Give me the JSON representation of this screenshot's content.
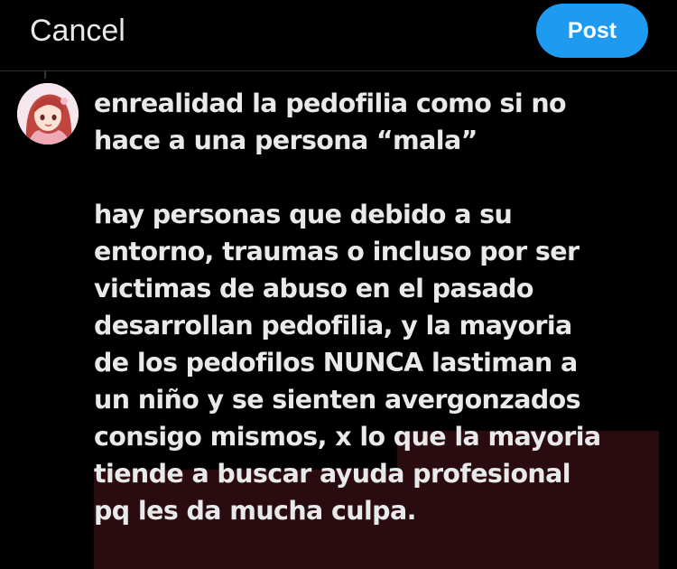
{
  "header": {
    "cancel_label": "Cancel",
    "post_label": "Post"
  },
  "colors": {
    "background": "#000000",
    "post_button": "#1d9bf0",
    "text": "#e7e9ea",
    "quote_highlight": "#2a0c10"
  },
  "quoted_post": {
    "avatar_icon": "anime-avatar-icon",
    "text": "enrealidad la pedofilia como si no\nhace a una persona “mala”\n\nhay personas que debido a su\nentorno, traumas o incluso por ser\nvictimas de abuso en el pasado\ndesarrollan pedofilia, y la mayoria\nde los pedofilos NUNCA lastiman a\nun niño y se sienten avergonzados\nconsigo mismos, x lo que la mayoria\ntiende a buscar ayuda profesional\npq les da mucha culpa."
  }
}
